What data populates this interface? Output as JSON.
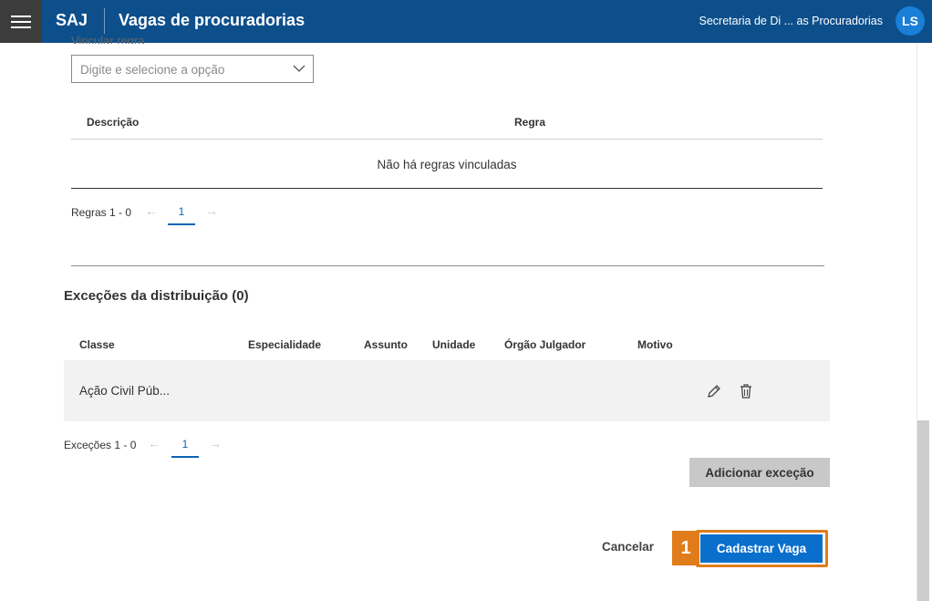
{
  "header": {
    "brand": "SAJ",
    "title": "Vagas de procuradorias",
    "org": "Secretaria de Di ... as Procuradorias",
    "avatar_initials": "LS"
  },
  "rules": {
    "field_label": "Vincular regra",
    "select_placeholder": "Digite e selecione a opção",
    "columns": [
      "Descrição",
      "Regra"
    ],
    "empty_message": "Não há regras vinculadas",
    "pager_label": "Regras 1 - 0",
    "current_page": "1"
  },
  "exceptions": {
    "title": "Exceções da distribuição (0)",
    "columns": [
      "Classe",
      "Especialidade",
      "Assunto",
      "Unidade",
      "Órgão Julgador",
      "Motivo"
    ],
    "rows": [
      {
        "classe": "Ação Civil Púb..."
      }
    ],
    "pager_label": "Exceções 1 - 0",
    "current_page": "1",
    "add_button": "Adicionar exceção"
  },
  "actions": {
    "cancel": "Cancelar",
    "submit": "Cadastrar Vaga",
    "callout_number": "1"
  },
  "colors": {
    "header_bg": "#0d4f8b",
    "primary": "#0a6fcc",
    "callout": "#e07c1a"
  },
  "icons": [
    "menu-icon",
    "chevron-down-icon",
    "arrow-left-icon",
    "arrow-right-icon",
    "pencil-icon",
    "trash-icon"
  ]
}
